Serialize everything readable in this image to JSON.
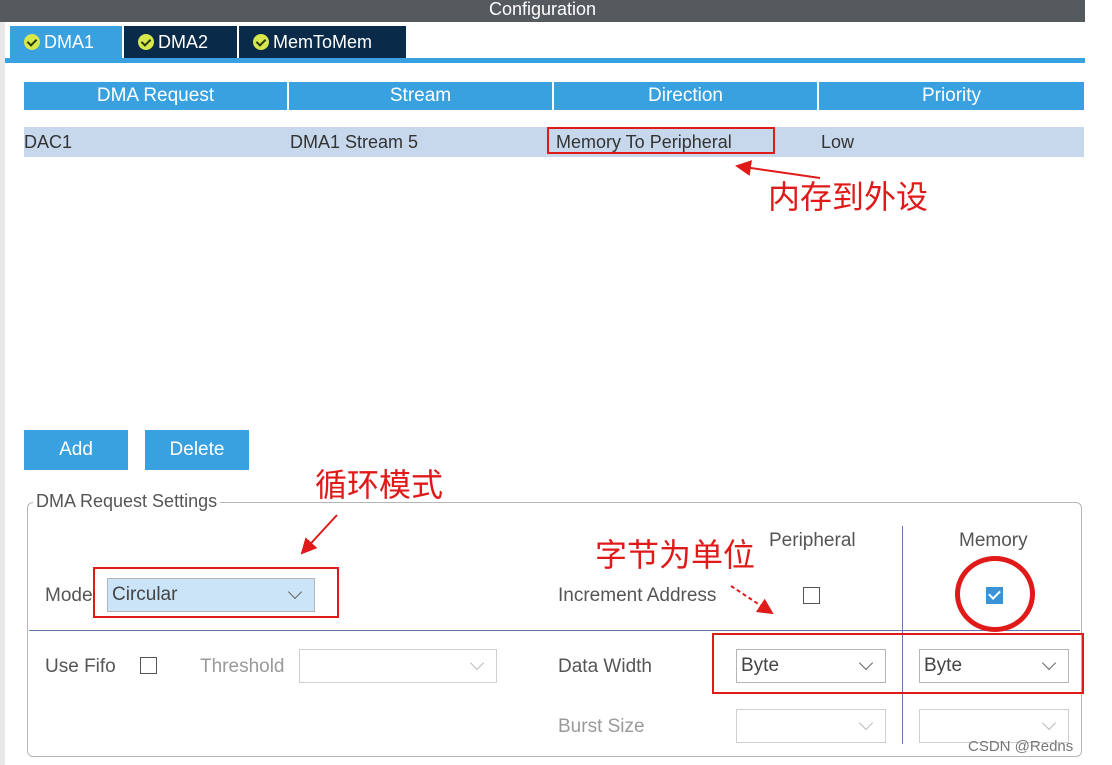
{
  "window": {
    "title": "Configuration"
  },
  "tabs": [
    {
      "label": "DMA1",
      "active": true
    },
    {
      "label": "DMA2",
      "active": false
    },
    {
      "label": "MemToMem",
      "active": false
    }
  ],
  "table": {
    "headers": [
      "DMA Request",
      "Stream",
      "Direction",
      "Priority"
    ],
    "rows": [
      {
        "request": "DAC1",
        "stream": "DMA1 Stream 5",
        "direction": "Memory To Peripheral",
        "priority": "Low"
      }
    ]
  },
  "buttons": {
    "add": "Add",
    "delete": "Delete"
  },
  "settings": {
    "group_title": "DMA Request Settings",
    "mode_label": "Mode",
    "mode_value": "Circular",
    "peripheral_header": "Peripheral",
    "memory_header": "Memory",
    "increment_address_label": "Increment Address",
    "peripheral_increment": false,
    "memory_increment": true,
    "use_fifo_label": "Use Fifo",
    "use_fifo": false,
    "threshold_label": "Threshold",
    "threshold_value": "",
    "data_width_label": "Data Width",
    "peripheral_data_width": "Byte",
    "memory_data_width": "Byte",
    "burst_size_label": "Burst Size",
    "peripheral_burst_size": "",
    "memory_burst_size": ""
  },
  "annotations": {
    "direction_note": "内存到外设",
    "mode_note": "循环模式",
    "width_note": "字节为单位"
  },
  "watermark": "CSDN @Redns",
  "colors": {
    "accent": "#39a1e0",
    "tab_dark": "#0a2a4a",
    "annotation_red": "#e01919",
    "row_selected": "#c8d8ec"
  }
}
